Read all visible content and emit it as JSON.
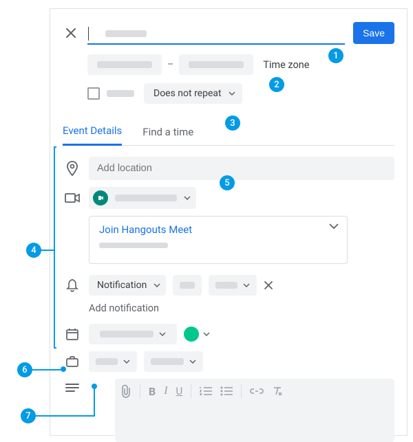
{
  "header": {
    "save_label": "Save"
  },
  "time": {
    "timezone_label": "Time zone",
    "repeat_label": "Does not repeat"
  },
  "tabs": {
    "details": "Event Details",
    "find": "Find a time"
  },
  "details": {
    "location_placeholder": "Add location",
    "meet_link": "Join Hangouts Meet",
    "notification_label": "Notification",
    "add_notification": "Add notification"
  },
  "callouts": {
    "c1": "1",
    "c2": "2",
    "c3": "3",
    "c4": "4",
    "c5": "5",
    "c6": "6",
    "c7": "7"
  }
}
